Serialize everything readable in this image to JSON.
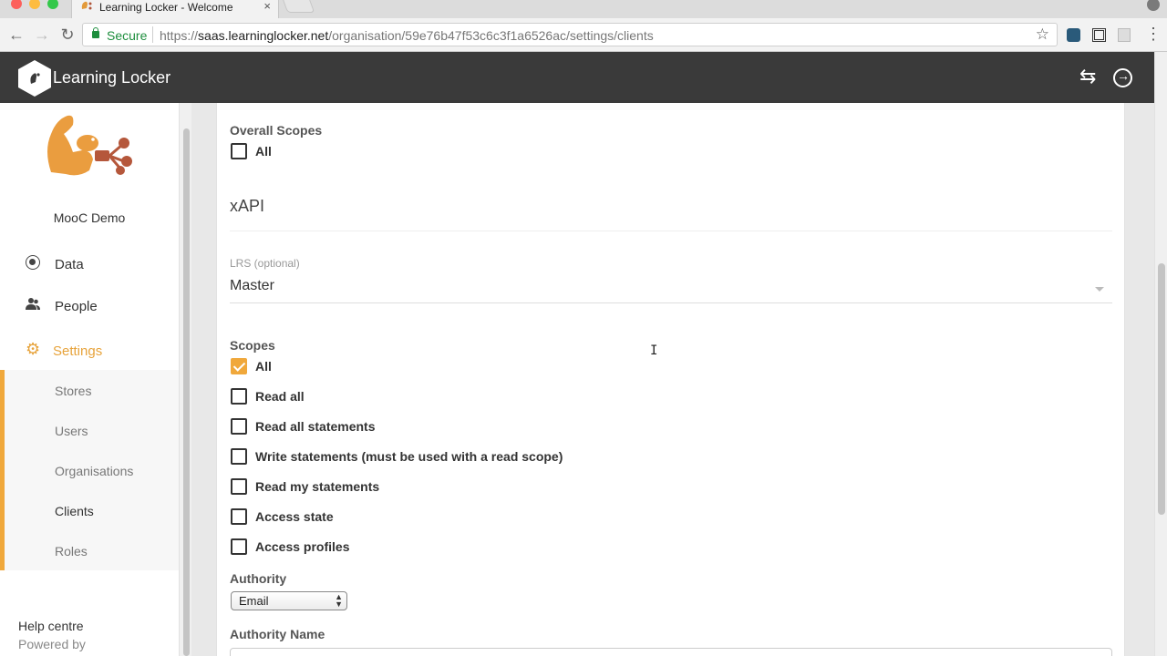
{
  "browser": {
    "tab_title": "Learning Locker - Welcome",
    "tab_close": "×",
    "secure_label": "Secure",
    "url_scheme": "https://",
    "url_host": "saas.learninglocker.net",
    "url_path": "/organisation/59e76b47f53c6c3f1a6526ac/settings/clients",
    "icons": [
      "back-icon",
      "forward-icon",
      "reload-icon",
      "lock-icon",
      "star-icon",
      "menu-icon"
    ]
  },
  "header": {
    "brand": "Learning Locker",
    "brand_color": "#3a3a3a",
    "icons": [
      "switch-org-icon",
      "logout-icon"
    ]
  },
  "sidebar": {
    "org_name": "MooC Demo",
    "items": [
      {
        "label": "Data",
        "icon": "radio-icon"
      },
      {
        "label": "People",
        "icon": "people-icon"
      },
      {
        "label": "Settings",
        "icon": "gear-icon",
        "active": true
      }
    ],
    "settings_subitems": [
      "Stores",
      "Users",
      "Organisations",
      "Clients",
      "Roles"
    ],
    "help": "Help centre",
    "powered_by": "Powered by",
    "accent_color": "#f0a83b"
  },
  "form": {
    "overall_scopes_label": "Overall Scopes",
    "overall_scopes": [
      {
        "label": "All",
        "checked": false
      }
    ],
    "xapi_title": "xAPI",
    "lrs_label": "LRS (optional)",
    "lrs_value": "Master",
    "scopes_label": "Scopes",
    "scopes": [
      {
        "label": "All",
        "checked": true
      },
      {
        "label": "Read all",
        "checked": false
      },
      {
        "label": "Read all statements",
        "checked": false
      },
      {
        "label": "Write statements (must be used with a read scope)",
        "checked": false
      },
      {
        "label": "Read my statements",
        "checked": false
      },
      {
        "label": "Access state",
        "checked": false
      },
      {
        "label": "Access profiles",
        "checked": false
      }
    ],
    "authority_label": "Authority",
    "authority_value": "Email",
    "authority_name_label": "Authority Name"
  }
}
